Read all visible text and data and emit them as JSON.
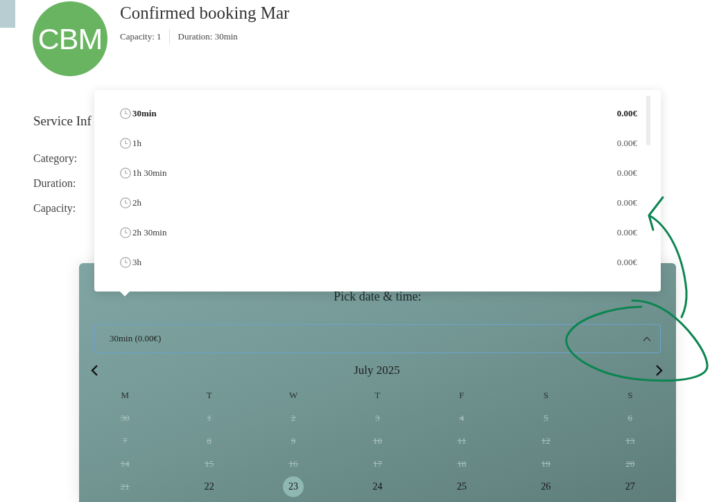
{
  "header": {
    "avatar_initials": "CBM",
    "title": "Confirmed booking Mar",
    "meta": [
      "Capacity: 1",
      "Duration: 30min"
    ]
  },
  "service_info": {
    "heading": "Service Inf",
    "fields": [
      "Category:",
      "Duration:",
      "Capacity:"
    ]
  },
  "duration_dropdown": {
    "items": [
      {
        "label": "30min",
        "price": "0.00€",
        "selected": true
      },
      {
        "label": "1h",
        "price": "0.00€",
        "selected": false
      },
      {
        "label": "1h 30min",
        "price": "0.00€",
        "selected": false
      },
      {
        "label": "2h",
        "price": "0.00€",
        "selected": false
      },
      {
        "label": "2h 30min",
        "price": "0.00€",
        "selected": false
      },
      {
        "label": "3h",
        "price": "0.00€",
        "selected": false
      }
    ]
  },
  "booking_panel": {
    "title": "Pick date & time:",
    "duration_select": {
      "value": "30min (0.00€)",
      "expanded": true
    },
    "calendar": {
      "month": "July 2025",
      "weekdays": [
        "M",
        "T",
        "W",
        "T",
        "F",
        "S",
        "S"
      ],
      "weeks": [
        [
          {
            "day": "30",
            "disabled": true,
            "selected": false
          },
          {
            "day": "1",
            "disabled": true,
            "selected": false
          },
          {
            "day": "2",
            "disabled": true,
            "selected": false
          },
          {
            "day": "3",
            "disabled": true,
            "selected": false
          },
          {
            "day": "4",
            "disabled": true,
            "selected": false
          },
          {
            "day": "5",
            "disabled": true,
            "selected": false
          },
          {
            "day": "6",
            "disabled": true,
            "selected": false
          }
        ],
        [
          {
            "day": "7",
            "disabled": true,
            "selected": false
          },
          {
            "day": "8",
            "disabled": true,
            "selected": false
          },
          {
            "day": "9",
            "disabled": true,
            "selected": false
          },
          {
            "day": "10",
            "disabled": true,
            "selected": false
          },
          {
            "day": "11",
            "disabled": true,
            "selected": false
          },
          {
            "day": "12",
            "disabled": true,
            "selected": false
          },
          {
            "day": "13",
            "disabled": true,
            "selected": false
          }
        ],
        [
          {
            "day": "14",
            "disabled": true,
            "selected": false
          },
          {
            "day": "15",
            "disabled": true,
            "selected": false
          },
          {
            "day": "16",
            "disabled": true,
            "selected": false
          },
          {
            "day": "17",
            "disabled": true,
            "selected": false
          },
          {
            "day": "18",
            "disabled": true,
            "selected": false
          },
          {
            "day": "19",
            "disabled": true,
            "selected": false
          },
          {
            "day": "20",
            "disabled": true,
            "selected": false
          }
        ],
        [
          {
            "day": "21",
            "disabled": true,
            "selected": false
          },
          {
            "day": "22",
            "disabled": false,
            "selected": false
          },
          {
            "day": "23",
            "disabled": false,
            "selected": true
          },
          {
            "day": "24",
            "disabled": false,
            "selected": false
          },
          {
            "day": "25",
            "disabled": false,
            "selected": false
          },
          {
            "day": "26",
            "disabled": false,
            "selected": false
          },
          {
            "day": "27",
            "disabled": false,
            "selected": false
          }
        ]
      ]
    }
  },
  "annotations": [
    {
      "kind": "arrow"
    },
    {
      "kind": "loop"
    }
  ]
}
